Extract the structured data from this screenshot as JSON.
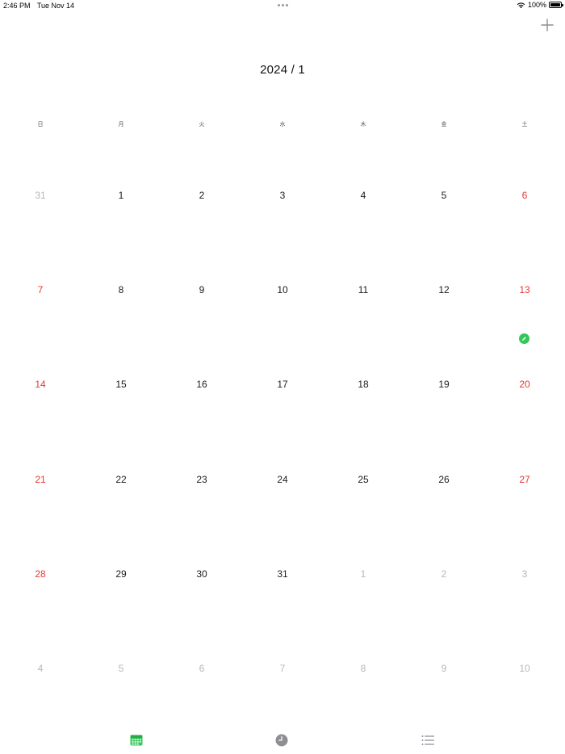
{
  "status_bar": {
    "time": "2:46 PM",
    "date": "Tue Nov 14",
    "battery": "100%"
  },
  "header": {
    "title": "2024 / 1"
  },
  "weekdays": [
    "日",
    "月",
    "火",
    "水",
    "木",
    "金",
    "土"
  ],
  "days": [
    {
      "label": "31",
      "kind": "other"
    },
    {
      "label": "1",
      "kind": "normal"
    },
    {
      "label": "2",
      "kind": "normal"
    },
    {
      "label": "3",
      "kind": "normal"
    },
    {
      "label": "4",
      "kind": "normal"
    },
    {
      "label": "5",
      "kind": "normal"
    },
    {
      "label": "6",
      "kind": "holiday"
    },
    {
      "label": "7",
      "kind": "holiday"
    },
    {
      "label": "8",
      "kind": "normal"
    },
    {
      "label": "9",
      "kind": "normal"
    },
    {
      "label": "10",
      "kind": "normal"
    },
    {
      "label": "11",
      "kind": "normal"
    },
    {
      "label": "12",
      "kind": "normal"
    },
    {
      "label": "13",
      "kind": "holiday",
      "event": true
    },
    {
      "label": "14",
      "kind": "holiday"
    },
    {
      "label": "15",
      "kind": "normal"
    },
    {
      "label": "16",
      "kind": "normal"
    },
    {
      "label": "17",
      "kind": "normal"
    },
    {
      "label": "18",
      "kind": "normal"
    },
    {
      "label": "19",
      "kind": "normal"
    },
    {
      "label": "20",
      "kind": "holiday"
    },
    {
      "label": "21",
      "kind": "holiday"
    },
    {
      "label": "22",
      "kind": "normal"
    },
    {
      "label": "23",
      "kind": "normal"
    },
    {
      "label": "24",
      "kind": "normal"
    },
    {
      "label": "25",
      "kind": "normal"
    },
    {
      "label": "26",
      "kind": "normal"
    },
    {
      "label": "27",
      "kind": "holiday"
    },
    {
      "label": "28",
      "kind": "holiday"
    },
    {
      "label": "29",
      "kind": "normal"
    },
    {
      "label": "30",
      "kind": "normal"
    },
    {
      "label": "31",
      "kind": "normal"
    },
    {
      "label": "1",
      "kind": "other"
    },
    {
      "label": "2",
      "kind": "other"
    },
    {
      "label": "3",
      "kind": "other"
    },
    {
      "label": "4",
      "kind": "other"
    },
    {
      "label": "5",
      "kind": "other"
    },
    {
      "label": "6",
      "kind": "other"
    },
    {
      "label": "7",
      "kind": "other"
    },
    {
      "label": "8",
      "kind": "other"
    },
    {
      "label": "9",
      "kind": "other"
    },
    {
      "label": "10",
      "kind": "other"
    }
  ],
  "icons": {
    "add": "plus-icon",
    "event": "pencil-icon",
    "tab_calendar": "calendar-icon",
    "tab_clock": "clock-icon",
    "tab_list": "list-icon"
  },
  "colors": {
    "accent": "#34c759",
    "holiday": "#e53935",
    "muted": "#b8b8bc",
    "tab_inactive": "#8e8e93"
  }
}
